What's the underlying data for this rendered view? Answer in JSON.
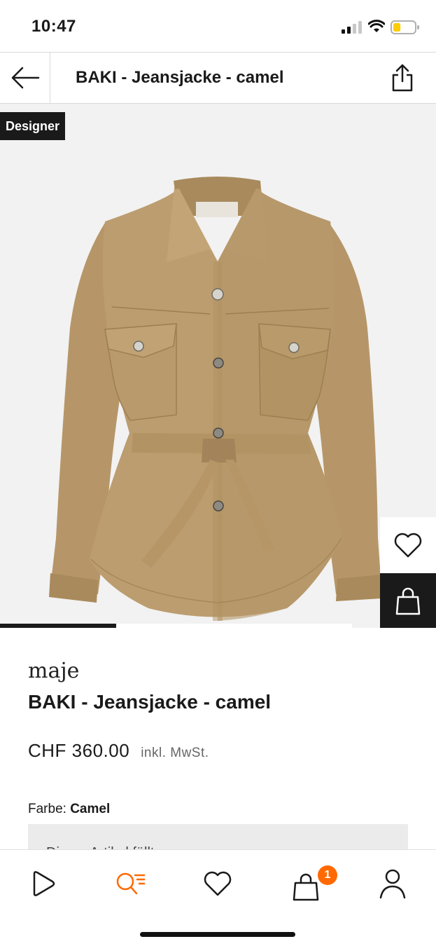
{
  "status_bar": {
    "time": "10:47",
    "signal_icon": "cellular-signal-icon",
    "wifi_icon": "wifi-icon",
    "battery_icon": "battery-icon",
    "battery_level": 0.35,
    "battery_color": "#ffcc00"
  },
  "header": {
    "title": "BAKI - Jeansjacke - camel",
    "back_icon": "arrow-left-icon",
    "share_icon": "share-icon"
  },
  "gallery": {
    "badge": "Designer",
    "image_alt": "camel shirt jacket",
    "image_progress": 0.33,
    "wishlist_icon": "heart-icon",
    "cart_icon": "shopping-bag-icon"
  },
  "product": {
    "brand": "maje",
    "name": "BAKI - Jeansjacke - camel",
    "price": "CHF 360.00",
    "vat_note": "inkl. MwSt.",
    "color_label": "Farbe:",
    "color_value": "Camel",
    "info_text": "Dieser Artikel fällt..."
  },
  "bottom_nav": {
    "items": [
      {
        "name": "home",
        "icon": "play-logo-icon"
      },
      {
        "name": "search",
        "icon": "search-list-icon",
        "active": true
      },
      {
        "name": "wishlist",
        "icon": "heart-icon"
      },
      {
        "name": "cart",
        "icon": "shopping-bag-icon",
        "badge": "1"
      },
      {
        "name": "profile",
        "icon": "person-icon"
      }
    ]
  },
  "colors": {
    "accent": "#ff6900",
    "text": "#1a1a1a",
    "jacket": "#b89a6e",
    "image_bg": "#f2f2f2"
  }
}
